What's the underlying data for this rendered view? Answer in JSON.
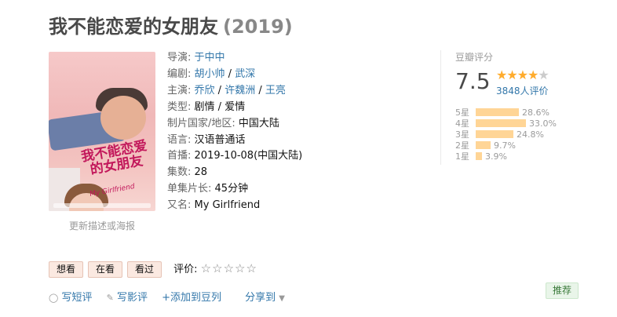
{
  "title": "我不能恋爱的女朋友",
  "year": "(2019)",
  "poster": {
    "title_text": "我不能恋爱的女朋友",
    "en_text": "My Girlfriend"
  },
  "update_link": "更新描述或海报",
  "info": {
    "director_label": "导演:",
    "director": "于中中",
    "writer_label": "编剧:",
    "writers": [
      "胡小帅",
      "武深"
    ],
    "cast_label": "主演:",
    "cast": [
      "乔欣",
      "许魏洲",
      "王亮"
    ],
    "genre_label": "类型:",
    "genres": [
      "剧情",
      "爱情"
    ],
    "region_label": "制片国家/地区:",
    "region": "中国大陆",
    "language_label": "语言:",
    "language": "汉语普通话",
    "premiere_label": "首播:",
    "premiere": "2019-10-08(中国大陆)",
    "episodes_label": "集数:",
    "episodes": "28",
    "duration_label": "单集片长:",
    "duration": "45分钟",
    "aka_label": "又名:",
    "aka": "My Girlfriend",
    "sep": " / "
  },
  "rating": {
    "label": "豆瓣评分",
    "score": "7.5",
    "stars": 4,
    "count": "3848人评价",
    "star_color": "#ffac2d",
    "distribution": [
      {
        "label": "5星",
        "pct": "28.6%",
        "value": 28.6
      },
      {
        "label": "4星",
        "pct": "33.0%",
        "value": 33.0
      },
      {
        "label": "3星",
        "pct": "24.8%",
        "value": 24.8
      },
      {
        "label": "2星",
        "pct": "9.7%",
        "value": 9.7
      },
      {
        "label": "1星",
        "pct": "3.9%",
        "value": 3.9
      }
    ]
  },
  "buttons": {
    "want": "想看",
    "watching": "在看",
    "watched": "看过",
    "rate_label": "评价:",
    "rate_stars": "☆☆☆☆☆"
  },
  "actions": {
    "short_review": "写短评",
    "review": "写影评",
    "add_doulist": "+添加到豆列",
    "share": "分享到"
  },
  "recommend": "推荐"
}
